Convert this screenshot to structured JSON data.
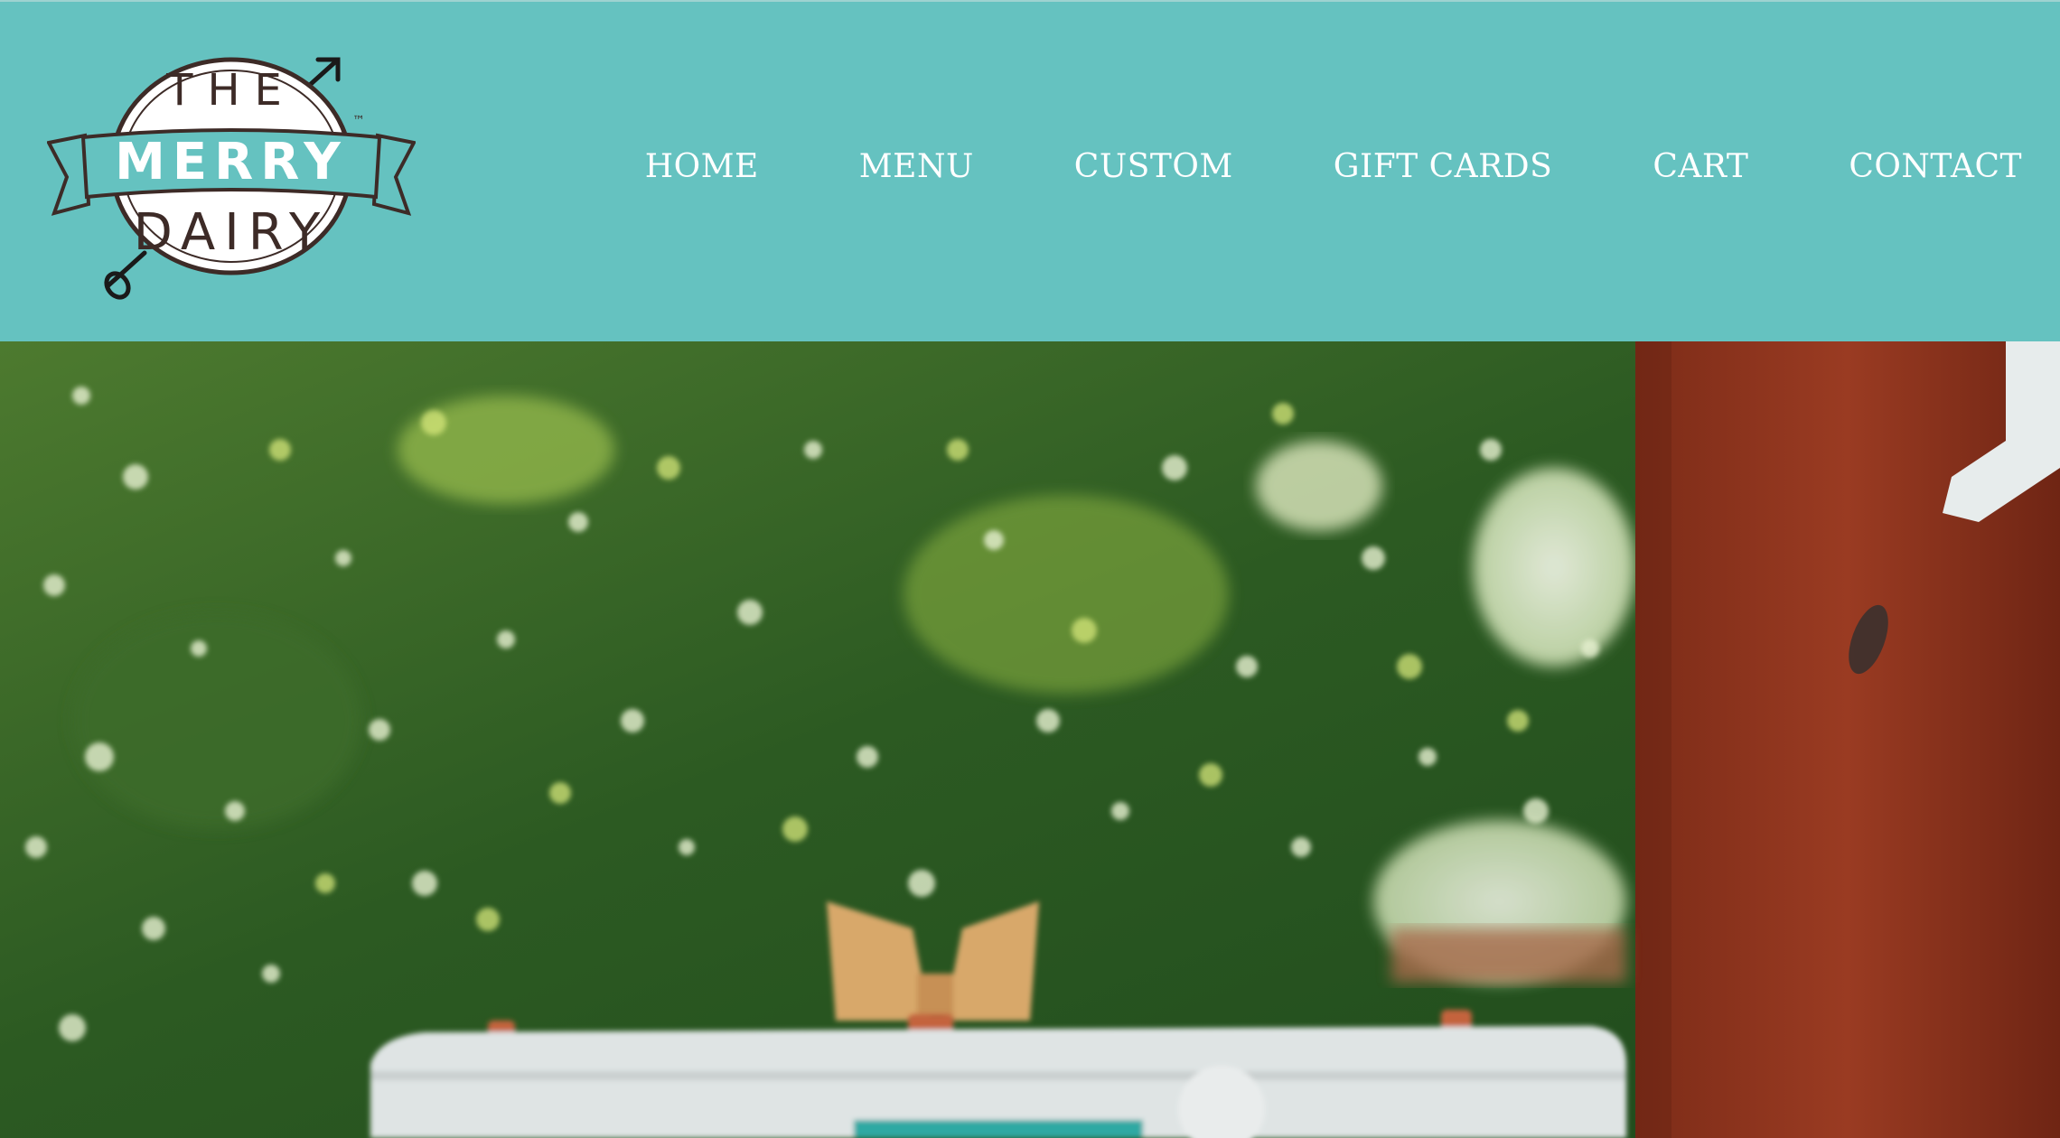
{
  "brand": {
    "logo_top": "THE",
    "logo_banner": "MERRY",
    "logo_bottom": "DAIRY",
    "trademark": "™",
    "header_color": "#65c2c0",
    "logo_ink": "#3d2b27"
  },
  "nav": {
    "items": [
      {
        "label": "HOME"
      },
      {
        "label": "MENU"
      },
      {
        "label": "CUSTOM"
      },
      {
        "label": "GIFT CARDS"
      },
      {
        "label": "CART"
      },
      {
        "label": "CONTACT"
      }
    ]
  },
  "hero": {
    "subject": "ice cream truck under trees beside brick building"
  }
}
